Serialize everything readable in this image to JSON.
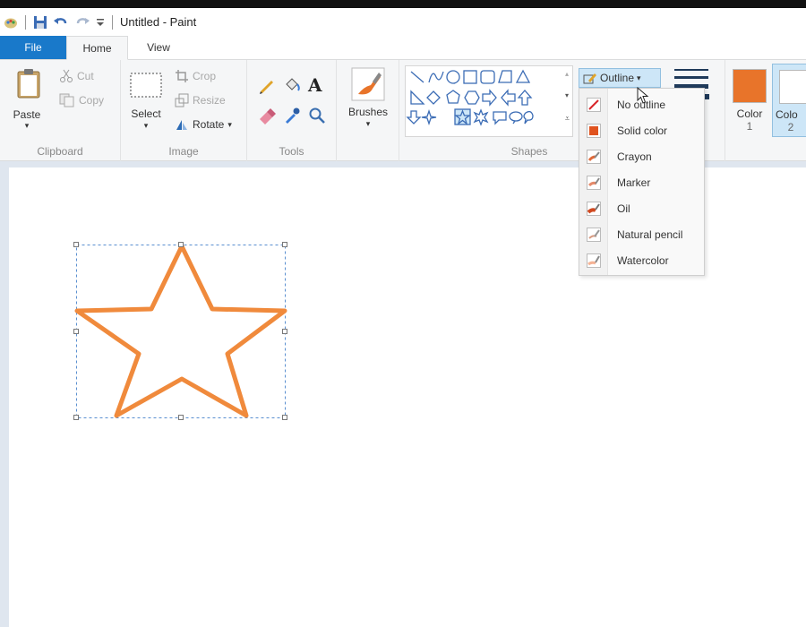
{
  "window": {
    "title": "Untitled - Paint"
  },
  "tabs": [
    {
      "label": "File"
    },
    {
      "label": "Home"
    },
    {
      "label": "View"
    }
  ],
  "clipboard": {
    "paste_label": "Paste",
    "cut_label": "Cut",
    "copy_label": "Copy",
    "group_label": "Clipboard"
  },
  "image": {
    "select_label": "Select",
    "crop_label": "Crop",
    "resize_label": "Resize",
    "rotate_label": "Rotate",
    "group_label": "Image"
  },
  "tools": {
    "group_label": "Tools",
    "text_tool_glyph": "A"
  },
  "brushes": {
    "label": "Brushes"
  },
  "shapes": {
    "group_label": "Shapes",
    "outline_label": "Outline"
  },
  "outline_menu": {
    "items": [
      {
        "label": "No outline",
        "icon": "no-outline-icon"
      },
      {
        "label": "Solid color",
        "icon": "solid-color-icon"
      },
      {
        "label": "Crayon",
        "icon": "crayon-icon"
      },
      {
        "label": "Marker",
        "icon": "marker-icon"
      },
      {
        "label": "Oil",
        "icon": "oil-icon"
      },
      {
        "label": "Natural pencil",
        "icon": "natural-pencil-icon"
      },
      {
        "label": "Watercolor",
        "icon": "watercolor-icon"
      }
    ]
  },
  "colors": {
    "color1_label": "Color",
    "color1_num": "1",
    "color2_label": "Colo",
    "color2_num": "2",
    "color1_hex": "#e8742a",
    "color2_hex": "#ffffff"
  },
  "theme": {
    "accent": "#1979ca",
    "star_stroke": "#f08a3c"
  }
}
